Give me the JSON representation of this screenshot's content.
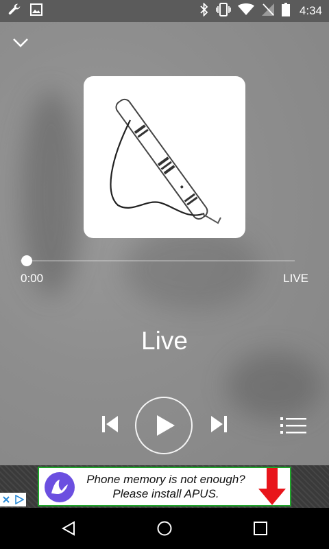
{
  "status_bar": {
    "time": "4:34",
    "left_icons": [
      "wrench-icon",
      "image-icon"
    ],
    "right_icons": [
      "bluetooth-icon",
      "vibrate-icon",
      "wifi-icon",
      "no-signal-icon",
      "battery-icon"
    ]
  },
  "player": {
    "position": "0:00",
    "duration": "LIVE",
    "progress": 0,
    "title": "Live",
    "artwork": "flute-artwork",
    "controls": [
      "chevron-down-icon",
      "previous-icon",
      "play-icon",
      "next-icon",
      "queue-icon"
    ]
  },
  "ad": {
    "line1": "Phone memory is not enough?",
    "line2": "Please install APUS.",
    "arrow_color": "#e8151b",
    "border_color": "#1fa52a",
    "logo_color": "#6b4fe0"
  },
  "nav_bar": {
    "buttons": [
      "back-icon",
      "home-icon",
      "recents-icon"
    ]
  }
}
